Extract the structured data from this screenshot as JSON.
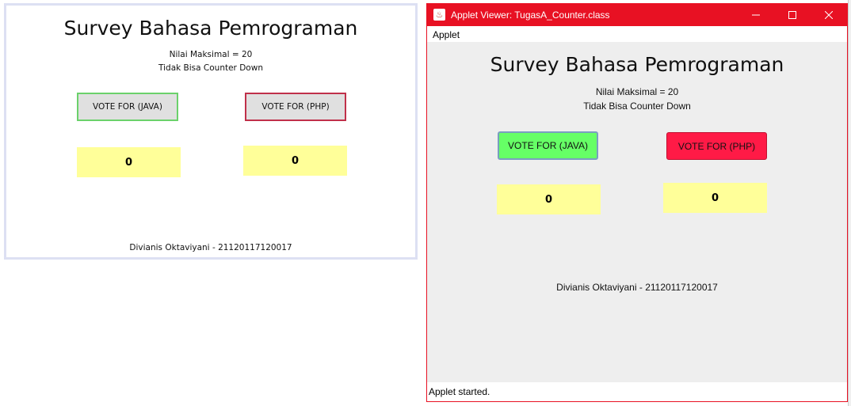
{
  "preview": {
    "title": "Survey Bahasa Pemrograman",
    "max_value": "Nilai Maksimal = 20",
    "no_countdown": "Tidak Bisa Counter Down",
    "java_button": "VOTE FOR (JAVA)",
    "php_button": "VOTE FOR (PHP)",
    "java_count": "0",
    "php_count": "0",
    "author": "Divianis Oktaviyani - 21120117120017"
  },
  "window": {
    "title": "Applet Viewer: TugasA_Counter.class",
    "minimize_icon": "minimize-icon",
    "maximize_icon": "maximize-icon",
    "close_icon": "close-icon",
    "menu": "Applet",
    "status": "Applet started."
  },
  "applet": {
    "title": "Survey Bahasa Pemrograman",
    "max_value": "Nilai Maksimal = 20",
    "no_countdown": "Tidak Bisa Counter Down",
    "java_button": "VOTE FOR (JAVA)",
    "php_button": "VOTE FOR (PHP)",
    "java_count": "0",
    "php_count": "0",
    "author": "Divianis Oktaviyani - 21120117120017"
  },
  "colors": {
    "titlebar": "#e81123",
    "java_button": "#66ff66",
    "php_button": "#ff1a46",
    "counter_bg": "#ffff99",
    "content_bg": "#eeeeee"
  }
}
